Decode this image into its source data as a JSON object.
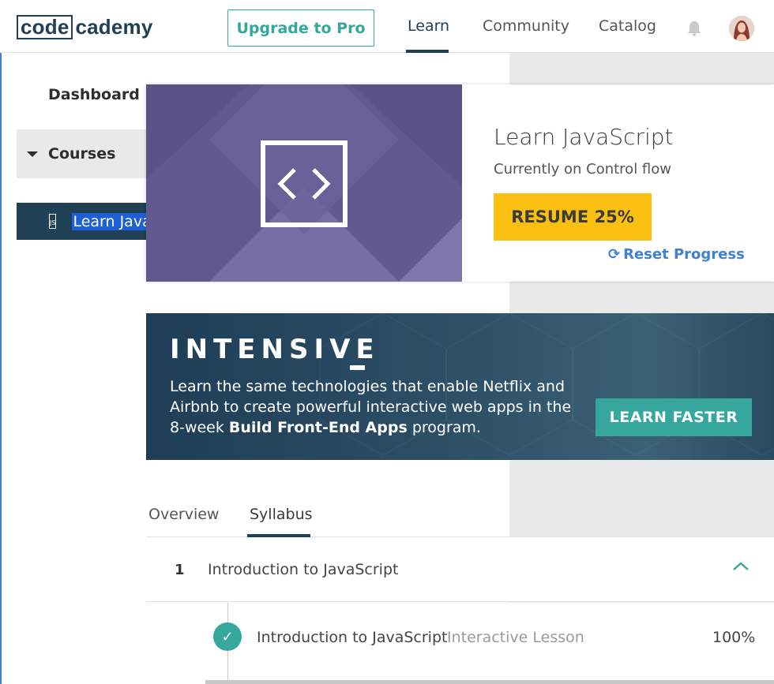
{
  "header": {
    "logo_box": "code",
    "logo_rest": "cademy",
    "upgrade_label": "Upgrade to Pro",
    "nav": {
      "learn": "Learn",
      "community": "Community",
      "catalog": "Catalog"
    },
    "icons": {
      "notifications": "bell-icon",
      "profile": "avatar"
    }
  },
  "sidebar": {
    "dashboard": "Dashboard",
    "courses": "Courses",
    "course_item_icon": "JS",
    "course_item_label": "Learn JavaScript"
  },
  "course_card": {
    "title": "Learn JavaScript",
    "subtitle": "Currently on Control flow",
    "resume_label": "RESUME 25%",
    "reset_label": "Reset Progress",
    "progress_percent": 25
  },
  "intensive": {
    "title": "INTENSIVE",
    "text_1": "Learn the same technologies that enable Netflix and Airbnb to create powerful interactive web apps in the 8-week ",
    "text_bold": "Build Front-End Apps",
    "text_2": " program.",
    "cta": "LEARN FASTER"
  },
  "tabs": {
    "overview": "Overview",
    "syllabus": "Syllabus"
  },
  "syllabus": {
    "unit_number": "1",
    "unit_title": "Introduction to JavaScript",
    "lessons": [
      {
        "title": "Introduction to JavaScript",
        "type": "Interactive Lesson",
        "percent": "100%"
      }
    ]
  },
  "colors": {
    "brand_navy": "#204056",
    "teal": "#35a79c",
    "resume_yellow": "#fbbf11",
    "link_blue": "#3f7fd6",
    "hero_purple": "#5a5387"
  }
}
